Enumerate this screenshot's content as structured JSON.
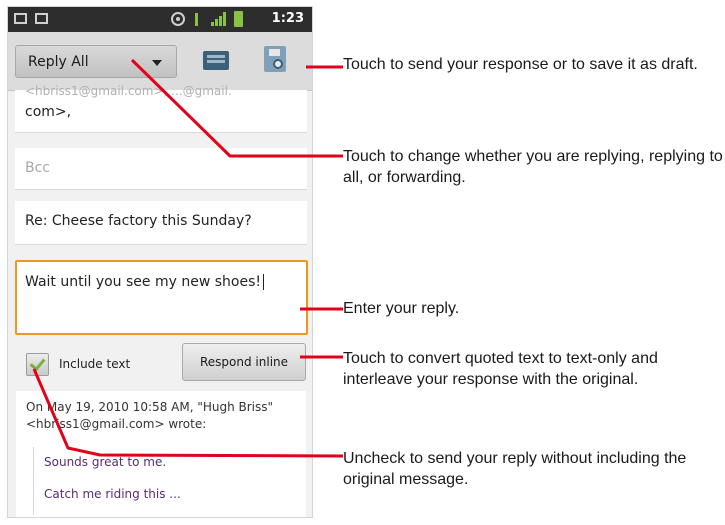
{
  "status_bar": {
    "time": "1:23"
  },
  "action_bar": {
    "reply_mode": "Reply All"
  },
  "compose": {
    "recipients_partial": "&lt;hbriss1@gmail.com&gt;, ...@gmail.",
    "recipients_tail": "com>,",
    "bcc_placeholder": "Bcc",
    "subject": "Re: Cheese factory this Sunday?",
    "body": "Wait until you see my new shoes!"
  },
  "quote_controls": {
    "include_text_label": "Include text",
    "include_text_checked": true,
    "respond_inline_label": "Respond inline"
  },
  "quoted_message": {
    "header": "On May 19, 2010 10:58 AM, \"Hugh Briss\" <hbriss1@gmail.com> wrote:",
    "lines": [
      "Sounds great to me.",
      "Catch me riding this ..."
    ]
  },
  "callouts": [
    "Touch to send your response or to save it as draft.",
    "Touch to change whether you are replying, replying to all, or forwarding.",
    "Enter your reply.",
    "Touch to convert quoted text to text-only and interleave your response with the original.",
    "Uncheck to send your reply without including the original message."
  ],
  "colors": {
    "callout_line": "#e3001b",
    "focus_border": "#f1961f",
    "status_icons": "#89c142",
    "quoted_text": "#5b2c6f"
  }
}
